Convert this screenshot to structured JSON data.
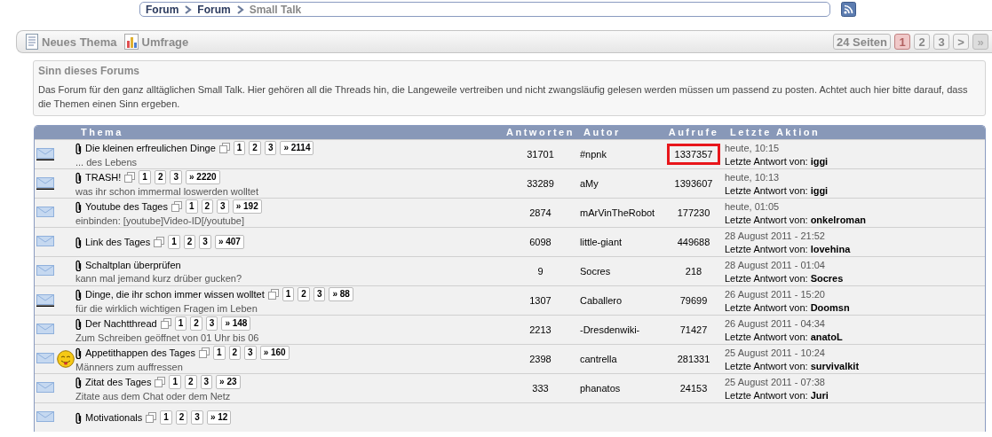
{
  "breadcrumb": [
    {
      "label": "Forum",
      "current": false
    },
    {
      "label": "Forum",
      "current": false
    },
    {
      "label": "Small Talk",
      "current": true
    }
  ],
  "toolbar": {
    "actions": [
      {
        "label": "Neues Thema",
        "kind": "document"
      },
      {
        "label": "Umfrage",
        "kind": "poll"
      }
    ],
    "pagination": {
      "summary": "24 Seiten",
      "pages": [
        {
          "label": "1",
          "selected": true
        },
        {
          "label": "2",
          "selected": false
        },
        {
          "label": "3",
          "selected": false
        },
        {
          "label": ">",
          "selected": false
        },
        {
          "label": "»",
          "selected": false,
          "disabled": true
        }
      ]
    }
  },
  "info": {
    "title": "Sinn dieses Forums",
    "text": "Das Forum für den ganz alltäglichen Small Talk. Hier gehören all die Threads hin, die Langeweile vertreiben und nicht zwangsläufig gelesen werden müssen um passend zu posten. Achtet auch hier bitte darauf, dass die Themen einen Sinn ergeben."
  },
  "table": {
    "columns": [
      "Thema",
      "Antworten",
      "Autor",
      "Aufrufe",
      "Letzte Aktion"
    ],
    "rows": [
      {
        "new": true,
        "emoticon": false,
        "title": "Die kleinen erfreulichen Dinge",
        "pages": [
          "1",
          "2",
          "3"
        ],
        "last_page": "» 2114",
        "description": "... des Lebens",
        "replies": "31701",
        "author": "#npnk",
        "views": "1337357",
        "highlighted": true,
        "last_date": "heute, 10:15",
        "last_label": "Letzte Antwort von:",
        "last_by": "iggi"
      },
      {
        "new": true,
        "emoticon": false,
        "title": "TRASH!",
        "pages": [
          "1",
          "2",
          "3"
        ],
        "last_page": "» 2220",
        "description": "was ihr schon immermal loswerden wolltet",
        "replies": "33289",
        "author": "aMy",
        "views": "1393607",
        "highlighted": false,
        "last_date": "heute, 10:13",
        "last_label": "Letzte Antwort von:",
        "last_by": "iggi"
      },
      {
        "new": false,
        "emoticon": false,
        "title": "Youtube des Tages",
        "pages": [
          "1",
          "2",
          "3"
        ],
        "last_page": "» 192",
        "description": "einbinden: [youtube]Video-ID[/youtube]",
        "replies": "2874",
        "author": "mArVinTheRobot",
        "views": "177230",
        "highlighted": false,
        "last_date": "heute, 01:05",
        "last_label": "Letzte Antwort von:",
        "last_by": "onkelroman"
      },
      {
        "new": false,
        "emoticon": false,
        "title": "Link des Tages",
        "pages": [
          "1",
          "2",
          "3"
        ],
        "last_page": "» 407",
        "replies": "6098",
        "author": "little-giant",
        "views": "449688",
        "highlighted": false,
        "last_date": "28 August 2011 - 21:52",
        "last_label": "Letzte Antwort von:",
        "last_by": "lovehina"
      },
      {
        "new": false,
        "emoticon": false,
        "title": "Schaltplan überprüfen",
        "pages": [],
        "description": "kann mal jemand kurz drüber gucken?",
        "replies": "9",
        "author": "Socres",
        "views": "218",
        "highlighted": false,
        "last_date": "28 August 2011 - 01:04",
        "last_label": "Letzte Antwort von:",
        "last_by": "Socres"
      },
      {
        "new": true,
        "emoticon": false,
        "title": "Dinge, die ihr schon immer wissen wolltet",
        "pages": [
          "1",
          "2",
          "3"
        ],
        "last_page": "» 88",
        "description": "für die wirklich wichtigen Fragen im Leben",
        "replies": "1307",
        "author": "Caballero",
        "views": "79699",
        "highlighted": false,
        "last_date": "26 August 2011 - 15:20",
        "last_label": "Letzte Antwort von:",
        "last_by": "Doomsn"
      },
      {
        "new": false,
        "emoticon": false,
        "title": "Der Nachtthread",
        "pages": [
          "1",
          "2",
          "3"
        ],
        "last_page": "» 148",
        "description": "Zum Schreiben geöffnet von 01 Uhr bis 06",
        "replies": "2213",
        "author": "-Dresdenwiki-",
        "views": "71427",
        "highlighted": false,
        "last_date": "26 August 2011 - 04:34",
        "last_label": "Letzte Antwort von:",
        "last_by": "anatoL"
      },
      {
        "new": false,
        "emoticon": true,
        "title": "Appetithappen des Tages",
        "pages": [
          "1",
          "2",
          "3"
        ],
        "last_page": "» 160",
        "description": "Männers zum auffressen",
        "replies": "2398",
        "author": "cantrella",
        "views": "281331",
        "highlighted": false,
        "last_date": "25 August 2011 - 10:24",
        "last_label": "Letzte Antwort von:",
        "last_by": "survivalkit"
      },
      {
        "new": false,
        "emoticon": false,
        "title": "Zitat des Tages",
        "pages": [
          "1",
          "2",
          "3"
        ],
        "last_page": "» 23",
        "description": "Zitate aus dem Chat oder dem Netz",
        "replies": "333",
        "author": "phanatos",
        "views": "24153",
        "highlighted": false,
        "last_date": "25 August 2011 - 07:38",
        "last_label": "Letzte Antwort von:",
        "last_by": "Juri"
      },
      {
        "new": false,
        "emoticon": false,
        "title": "Motivationals",
        "pages": [
          "1",
          "2",
          "3"
        ],
        "last_page": "» 12"
      }
    ]
  }
}
